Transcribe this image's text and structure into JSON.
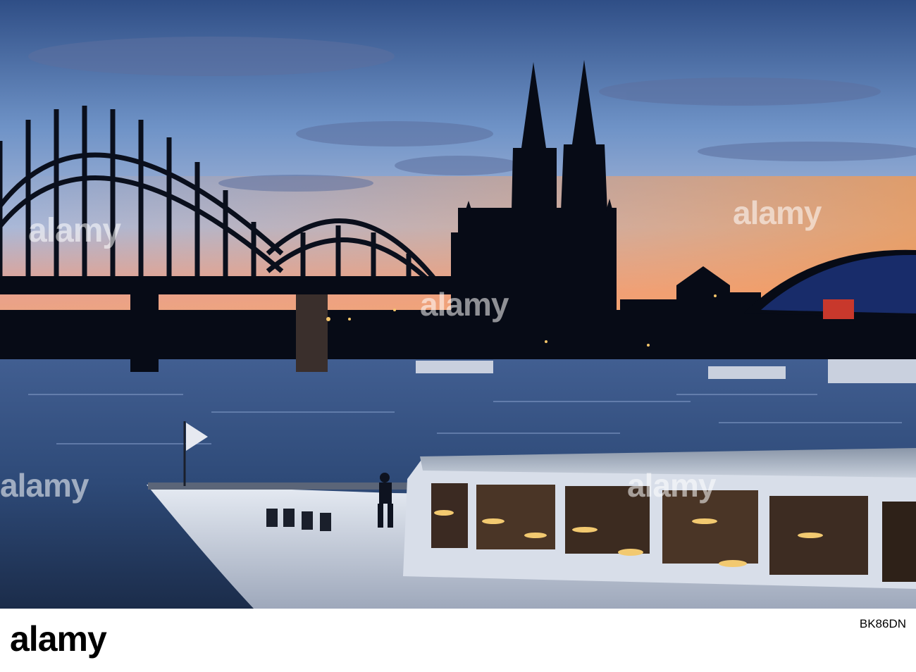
{
  "watermark": {
    "text": "alamy",
    "color": "#ffffff"
  },
  "footer": {
    "logo": "alamy",
    "image_id": "BK86DN",
    "background": "#ffffff"
  },
  "palette": {
    "sky_top": "#3a5a92",
    "sky_mid": "#7ea2d4",
    "sky_horizon": "#f3a06a",
    "water": "#3d5f93",
    "silhouette": "#070b16",
    "ship_hull": "#d9dee8",
    "window_glow": "#f2c970"
  }
}
